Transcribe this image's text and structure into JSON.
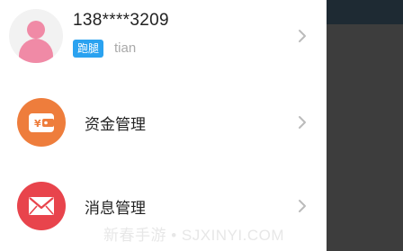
{
  "profile": {
    "phone": "138****3209",
    "badge": "跑腿",
    "username": "tian",
    "avatar_icon": "user-avatar-icon"
  },
  "menu": [
    {
      "label": "资金管理",
      "icon": "wallet-icon",
      "icon_color": "#ee7d3c"
    },
    {
      "label": "消息管理",
      "icon": "envelope-icon",
      "icon_color": "#e8444c"
    }
  ],
  "watermark": "新春手游 • SJXINYI.COM",
  "colors": {
    "badge": "#2aa2f0",
    "overlay": "#3d3d3d",
    "overlay_topbar": "#1e2a33",
    "avatar": "#f08aa6",
    "chevron": "#bbbbbb"
  }
}
